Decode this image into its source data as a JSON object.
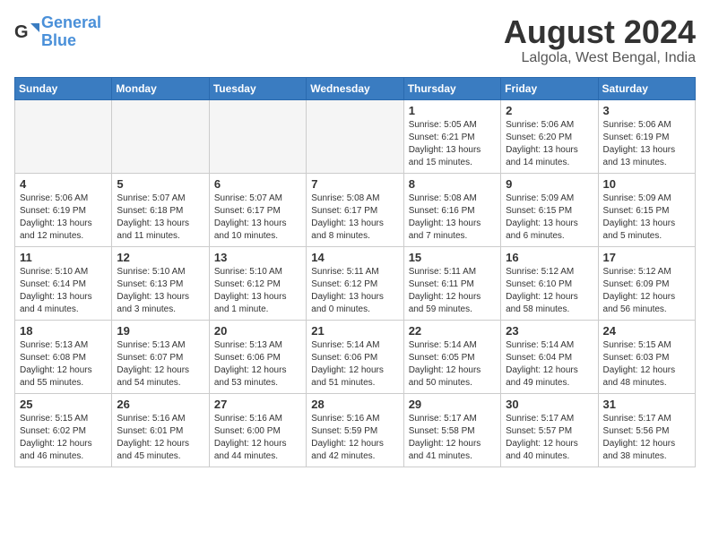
{
  "header": {
    "logo_line1": "General",
    "logo_line2": "Blue",
    "month": "August 2024",
    "location": "Lalgola, West Bengal, India"
  },
  "weekdays": [
    "Sunday",
    "Monday",
    "Tuesday",
    "Wednesday",
    "Thursday",
    "Friday",
    "Saturday"
  ],
  "weeks": [
    [
      {
        "day": "",
        "empty": true
      },
      {
        "day": "",
        "empty": true
      },
      {
        "day": "",
        "empty": true
      },
      {
        "day": "",
        "empty": true
      },
      {
        "day": "1",
        "sunrise": "Sunrise: 5:05 AM",
        "sunset": "Sunset: 6:21 PM",
        "daylight": "Daylight: 13 hours and 15 minutes."
      },
      {
        "day": "2",
        "sunrise": "Sunrise: 5:06 AM",
        "sunset": "Sunset: 6:20 PM",
        "daylight": "Daylight: 13 hours and 14 minutes."
      },
      {
        "day": "3",
        "sunrise": "Sunrise: 5:06 AM",
        "sunset": "Sunset: 6:19 PM",
        "daylight": "Daylight: 13 hours and 13 minutes."
      }
    ],
    [
      {
        "day": "4",
        "sunrise": "Sunrise: 5:06 AM",
        "sunset": "Sunset: 6:19 PM",
        "daylight": "Daylight: 13 hours and 12 minutes."
      },
      {
        "day": "5",
        "sunrise": "Sunrise: 5:07 AM",
        "sunset": "Sunset: 6:18 PM",
        "daylight": "Daylight: 13 hours and 11 minutes."
      },
      {
        "day": "6",
        "sunrise": "Sunrise: 5:07 AM",
        "sunset": "Sunset: 6:17 PM",
        "daylight": "Daylight: 13 hours and 10 minutes."
      },
      {
        "day": "7",
        "sunrise": "Sunrise: 5:08 AM",
        "sunset": "Sunset: 6:17 PM",
        "daylight": "Daylight: 13 hours and 8 minutes."
      },
      {
        "day": "8",
        "sunrise": "Sunrise: 5:08 AM",
        "sunset": "Sunset: 6:16 PM",
        "daylight": "Daylight: 13 hours and 7 minutes."
      },
      {
        "day": "9",
        "sunrise": "Sunrise: 5:09 AM",
        "sunset": "Sunset: 6:15 PM",
        "daylight": "Daylight: 13 hours and 6 minutes."
      },
      {
        "day": "10",
        "sunrise": "Sunrise: 5:09 AM",
        "sunset": "Sunset: 6:15 PM",
        "daylight": "Daylight: 13 hours and 5 minutes."
      }
    ],
    [
      {
        "day": "11",
        "sunrise": "Sunrise: 5:10 AM",
        "sunset": "Sunset: 6:14 PM",
        "daylight": "Daylight: 13 hours and 4 minutes."
      },
      {
        "day": "12",
        "sunrise": "Sunrise: 5:10 AM",
        "sunset": "Sunset: 6:13 PM",
        "daylight": "Daylight: 13 hours and 3 minutes."
      },
      {
        "day": "13",
        "sunrise": "Sunrise: 5:10 AM",
        "sunset": "Sunset: 6:12 PM",
        "daylight": "Daylight: 13 hours and 1 minute."
      },
      {
        "day": "14",
        "sunrise": "Sunrise: 5:11 AM",
        "sunset": "Sunset: 6:12 PM",
        "daylight": "Daylight: 13 hours and 0 minutes."
      },
      {
        "day": "15",
        "sunrise": "Sunrise: 5:11 AM",
        "sunset": "Sunset: 6:11 PM",
        "daylight": "Daylight: 12 hours and 59 minutes."
      },
      {
        "day": "16",
        "sunrise": "Sunrise: 5:12 AM",
        "sunset": "Sunset: 6:10 PM",
        "daylight": "Daylight: 12 hours and 58 minutes."
      },
      {
        "day": "17",
        "sunrise": "Sunrise: 5:12 AM",
        "sunset": "Sunset: 6:09 PM",
        "daylight": "Daylight: 12 hours and 56 minutes."
      }
    ],
    [
      {
        "day": "18",
        "sunrise": "Sunrise: 5:13 AM",
        "sunset": "Sunset: 6:08 PM",
        "daylight": "Daylight: 12 hours and 55 minutes."
      },
      {
        "day": "19",
        "sunrise": "Sunrise: 5:13 AM",
        "sunset": "Sunset: 6:07 PM",
        "daylight": "Daylight: 12 hours and 54 minutes."
      },
      {
        "day": "20",
        "sunrise": "Sunrise: 5:13 AM",
        "sunset": "Sunset: 6:06 PM",
        "daylight": "Daylight: 12 hours and 53 minutes."
      },
      {
        "day": "21",
        "sunrise": "Sunrise: 5:14 AM",
        "sunset": "Sunset: 6:06 PM",
        "daylight": "Daylight: 12 hours and 51 minutes."
      },
      {
        "day": "22",
        "sunrise": "Sunrise: 5:14 AM",
        "sunset": "Sunset: 6:05 PM",
        "daylight": "Daylight: 12 hours and 50 minutes."
      },
      {
        "day": "23",
        "sunrise": "Sunrise: 5:14 AM",
        "sunset": "Sunset: 6:04 PM",
        "daylight": "Daylight: 12 hours and 49 minutes."
      },
      {
        "day": "24",
        "sunrise": "Sunrise: 5:15 AM",
        "sunset": "Sunset: 6:03 PM",
        "daylight": "Daylight: 12 hours and 48 minutes."
      }
    ],
    [
      {
        "day": "25",
        "sunrise": "Sunrise: 5:15 AM",
        "sunset": "Sunset: 6:02 PM",
        "daylight": "Daylight: 12 hours and 46 minutes."
      },
      {
        "day": "26",
        "sunrise": "Sunrise: 5:16 AM",
        "sunset": "Sunset: 6:01 PM",
        "daylight": "Daylight: 12 hours and 45 minutes."
      },
      {
        "day": "27",
        "sunrise": "Sunrise: 5:16 AM",
        "sunset": "Sunset: 6:00 PM",
        "daylight": "Daylight: 12 hours and 44 minutes."
      },
      {
        "day": "28",
        "sunrise": "Sunrise: 5:16 AM",
        "sunset": "Sunset: 5:59 PM",
        "daylight": "Daylight: 12 hours and 42 minutes."
      },
      {
        "day": "29",
        "sunrise": "Sunrise: 5:17 AM",
        "sunset": "Sunset: 5:58 PM",
        "daylight": "Daylight: 12 hours and 41 minutes."
      },
      {
        "day": "30",
        "sunrise": "Sunrise: 5:17 AM",
        "sunset": "Sunset: 5:57 PM",
        "daylight": "Daylight: 12 hours and 40 minutes."
      },
      {
        "day": "31",
        "sunrise": "Sunrise: 5:17 AM",
        "sunset": "Sunset: 5:56 PM",
        "daylight": "Daylight: 12 hours and 38 minutes."
      }
    ]
  ]
}
